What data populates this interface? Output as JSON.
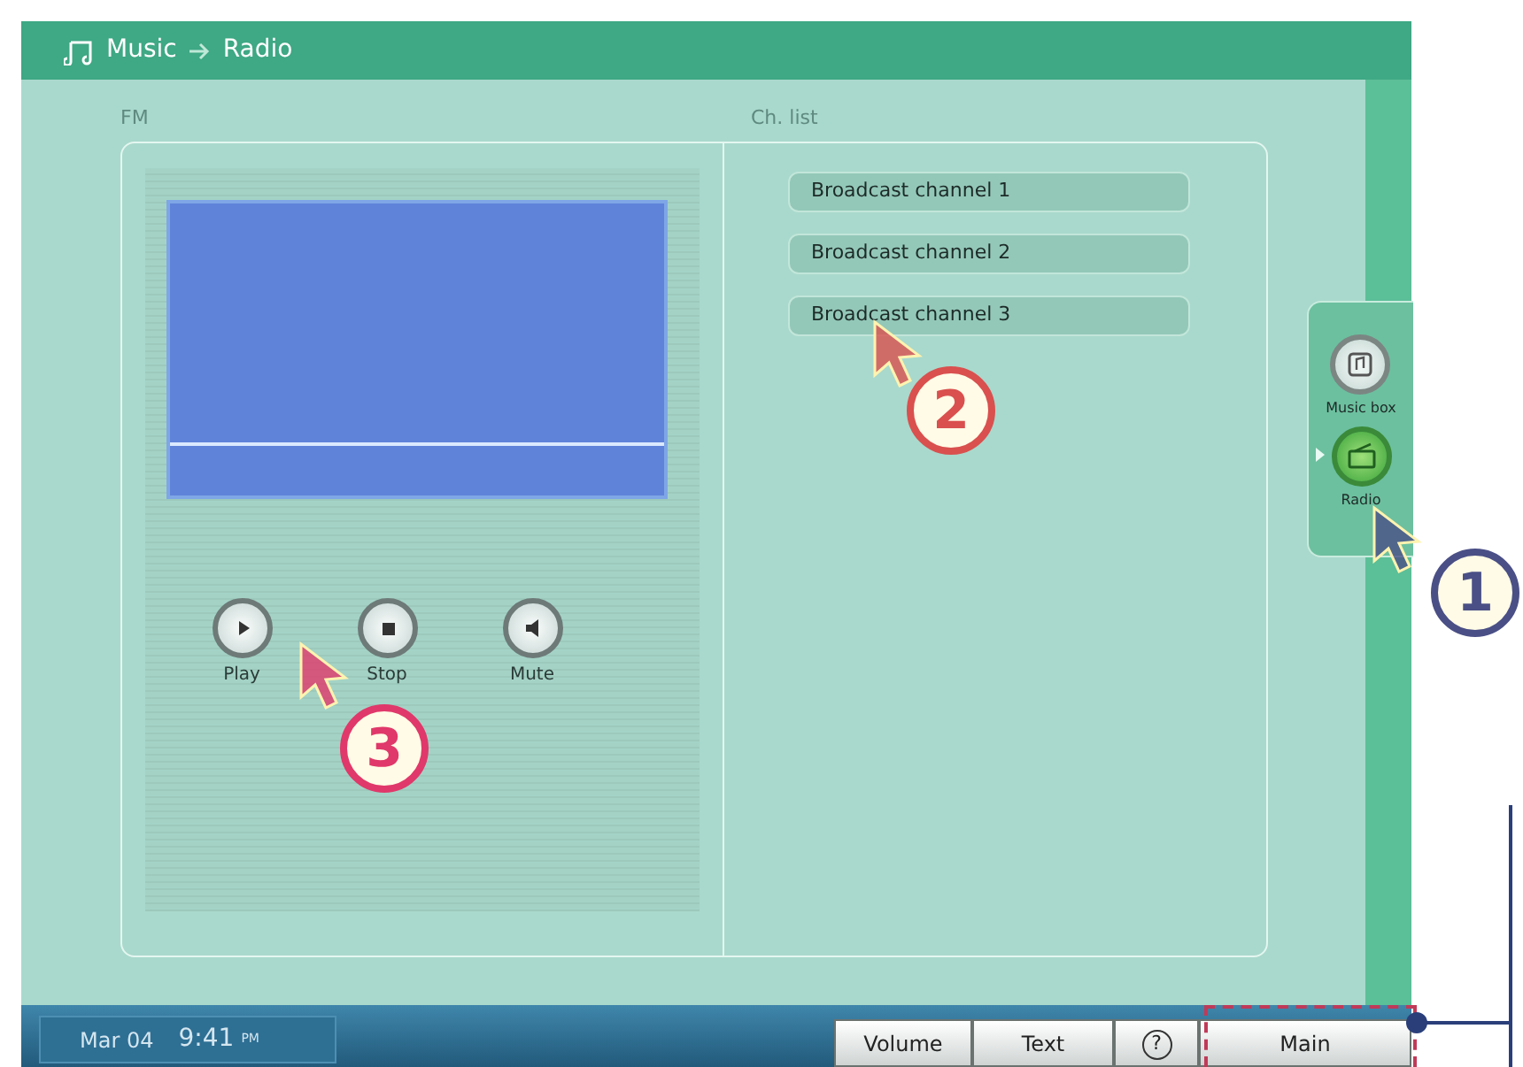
{
  "header": {
    "app": "Music",
    "section": "Radio"
  },
  "fm_panel": {
    "title": "FM",
    "controls": [
      {
        "label": "Play",
        "kind": "play"
      },
      {
        "label": "Stop",
        "kind": "stop"
      },
      {
        "label": "Mute",
        "kind": "mute"
      }
    ]
  },
  "channel_list": {
    "title": "Ch. list",
    "channels": [
      {
        "label": "Broadcast channel 1"
      },
      {
        "label": "Broadcast channel 2"
      },
      {
        "label": "Broadcast channel 3"
      }
    ]
  },
  "dock": [
    {
      "label": "Music box",
      "kind": "music",
      "selected": false
    },
    {
      "label": "Radio",
      "kind": "radio",
      "selected": true
    }
  ],
  "status": {
    "date": "Mar 04",
    "time": "9:41",
    "meridiem": "PM"
  },
  "buttons": [
    {
      "label": "Volume",
      "kind": "text"
    },
    {
      "label": "Text",
      "kind": "text"
    },
    {
      "label": "?",
      "kind": "help"
    },
    {
      "label": "Main",
      "kind": "text"
    }
  ],
  "callouts": [
    {
      "number": "1",
      "color": "#4a4f86"
    },
    {
      "number": "2",
      "color": "#d9504f"
    },
    {
      "number": "3",
      "color": "#e0386a"
    }
  ]
}
